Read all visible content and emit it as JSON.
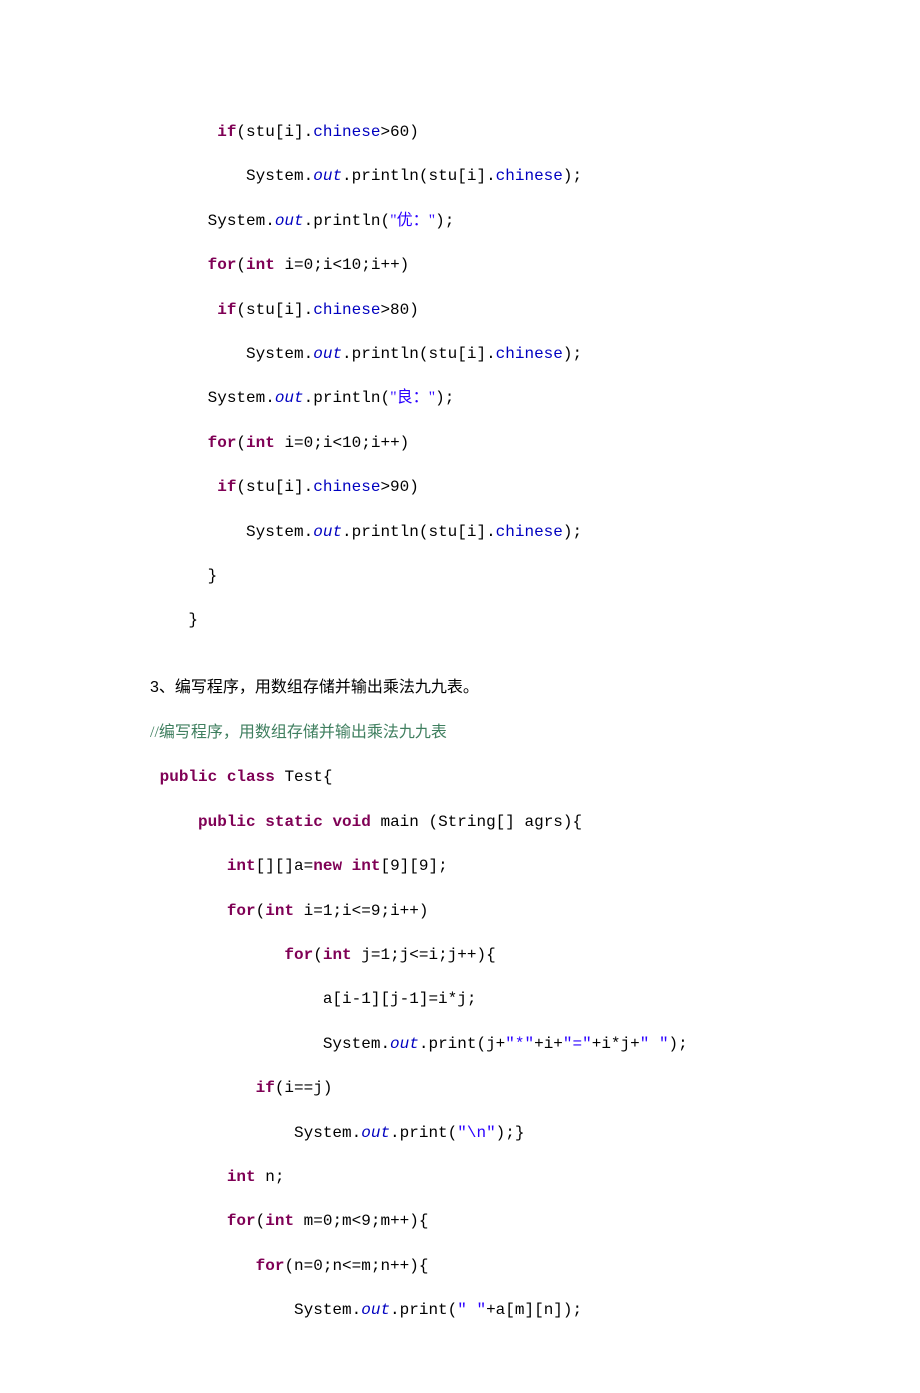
{
  "code1": {
    "l1a": "       ",
    "l1b": "if",
    "l1c": "(stu[i].",
    "l1d": "chinese",
    "l1e": ">60)",
    "l2a": "          System.",
    "l2b": "out",
    "l2c": ".println(stu[i].",
    "l2d": "chinese",
    "l2e": ");",
    "l3a": "      System.",
    "l3b": "out",
    "l3c": ".println(",
    "l3d": "\"优：\"",
    "l3e": ");",
    "l4a": "      ",
    "l4b": "for",
    "l4c": "(",
    "l4d": "int",
    "l4e": " i=0;i<10;i++)",
    "l5a": "       ",
    "l5b": "if",
    "l5c": "(stu[i].",
    "l5d": "chinese",
    "l5e": ">80)",
    "l6a": "          System.",
    "l6b": "out",
    "l6c": ".println(stu[i].",
    "l6d": "chinese",
    "l6e": ");",
    "l7a": "      System.",
    "l7b": "out",
    "l7c": ".println(",
    "l7d": "\"良：\"",
    "l7e": ");",
    "l8a": "      ",
    "l8b": "for",
    "l8c": "(",
    "l8d": "int",
    "l8e": " i=0;i<10;i++)",
    "l9a": "       ",
    "l9b": "if",
    "l9c": "(stu[i].",
    "l9d": "chinese",
    "l9e": ">90)",
    "l10a": "          System.",
    "l10b": "out",
    "l10c": ".println(stu[i].",
    "l10d": "chinese",
    "l10e": ");",
    "l11": "      }",
    "l12": "    }"
  },
  "problem": "3、编写程序，用数组存储并输出乘法九九表。",
  "code2": {
    "c1": "//编写程序，用数组存储并输出乘法九九表",
    "l1a": " ",
    "l1b": "public",
    "l1c": " ",
    "l1d": "class",
    "l1e": " Test{",
    "l2a": "     ",
    "l2b": "public",
    "l2c": " ",
    "l2d": "static",
    "l2e": " ",
    "l2f": "void",
    "l2g": " main (String[] agrs){",
    "l3a": "        ",
    "l3b": "int",
    "l3c": "[][]a=",
    "l3d": "new",
    "l3e": " ",
    "l3f": "int",
    "l3g": "[9][9];",
    "l4a": "        ",
    "l4b": "for",
    "l4c": "(",
    "l4d": "int",
    "l4e": " i=1;i<=9;i++)",
    "l5a": "              ",
    "l5b": "for",
    "l5c": "(",
    "l5d": "int",
    "l5e": " j=1;j<=i;j++){",
    "l6": "                  a[i-1][j-1]=i*j;",
    "l7a": "                  System.",
    "l7b": "out",
    "l7c": ".print(j+",
    "l7d": "\"*\"",
    "l7e": "+i+",
    "l7f": "\"=\"",
    "l7g": "+i*j+",
    "l7h": "\" \"",
    "l7i": ");",
    "l8a": "           ",
    "l8b": "if",
    "l8c": "(i==j)",
    "l9a": "               System.",
    "l9b": "out",
    "l9c": ".print(",
    "l9d": "\"\\n\"",
    "l9e": ");}",
    "l10a": "        ",
    "l10b": "int",
    "l10c": " n;",
    "l11a": "        ",
    "l11b": "for",
    "l11c": "(",
    "l11d": "int",
    "l11e": " m=0;m<9;m++){",
    "l12a": "           ",
    "l12b": "for",
    "l12c": "(n=0;n<=m;n++){",
    "l13a": "               System.",
    "l13b": "out",
    "l13c": ".print(",
    "l13d": "\" \"",
    "l13e": "+a[m][n]);"
  }
}
